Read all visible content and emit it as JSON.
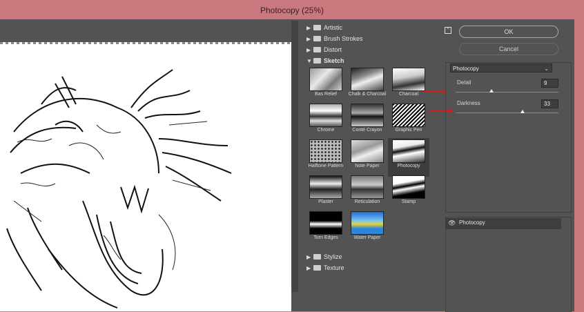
{
  "window": {
    "title": "Photocopy (25%)"
  },
  "categories_top": [
    {
      "label": "Artistic",
      "arrow": "▶"
    },
    {
      "label": "Brush Strokes",
      "arrow": "▶"
    },
    {
      "label": "Distort",
      "arrow": "▶"
    }
  ],
  "category_open": {
    "label": "Sketch",
    "arrow": "▼"
  },
  "filters": [
    {
      "label": "Bas Relief"
    },
    {
      "label": "Chalk & Charcoal"
    },
    {
      "label": "Charcoal"
    },
    {
      "label": "Chrome"
    },
    {
      "label": "Conté Crayon"
    },
    {
      "label": "Graphic Pen"
    },
    {
      "label": "Halftone Pattern"
    },
    {
      "label": "Note Paper"
    },
    {
      "label": "Photocopy"
    },
    {
      "label": "Plaster"
    },
    {
      "label": "Reticulation"
    },
    {
      "label": "Stamp"
    },
    {
      "label": "Torn Edges"
    },
    {
      "label": "Water Paper"
    }
  ],
  "selected_filter": "Photocopy",
  "categories_bottom": [
    {
      "label": "Stylize",
      "arrow": "▶"
    },
    {
      "label": "Texture",
      "arrow": "▶"
    }
  ],
  "buttons": {
    "ok": "OK",
    "cancel": "Cancel"
  },
  "filter_select": {
    "value": "Photocopy"
  },
  "params": {
    "detail": {
      "label": "Detail",
      "value": "9",
      "min": 1,
      "max": 24
    },
    "darkness": {
      "label": "Darkness",
      "value": "33",
      "min": 1,
      "max": 50
    }
  },
  "layer": {
    "name": "Photocopy"
  },
  "colors": {
    "titlebar": "#c9787d",
    "panel": "#535353",
    "arrow": "#cc1e1e"
  }
}
